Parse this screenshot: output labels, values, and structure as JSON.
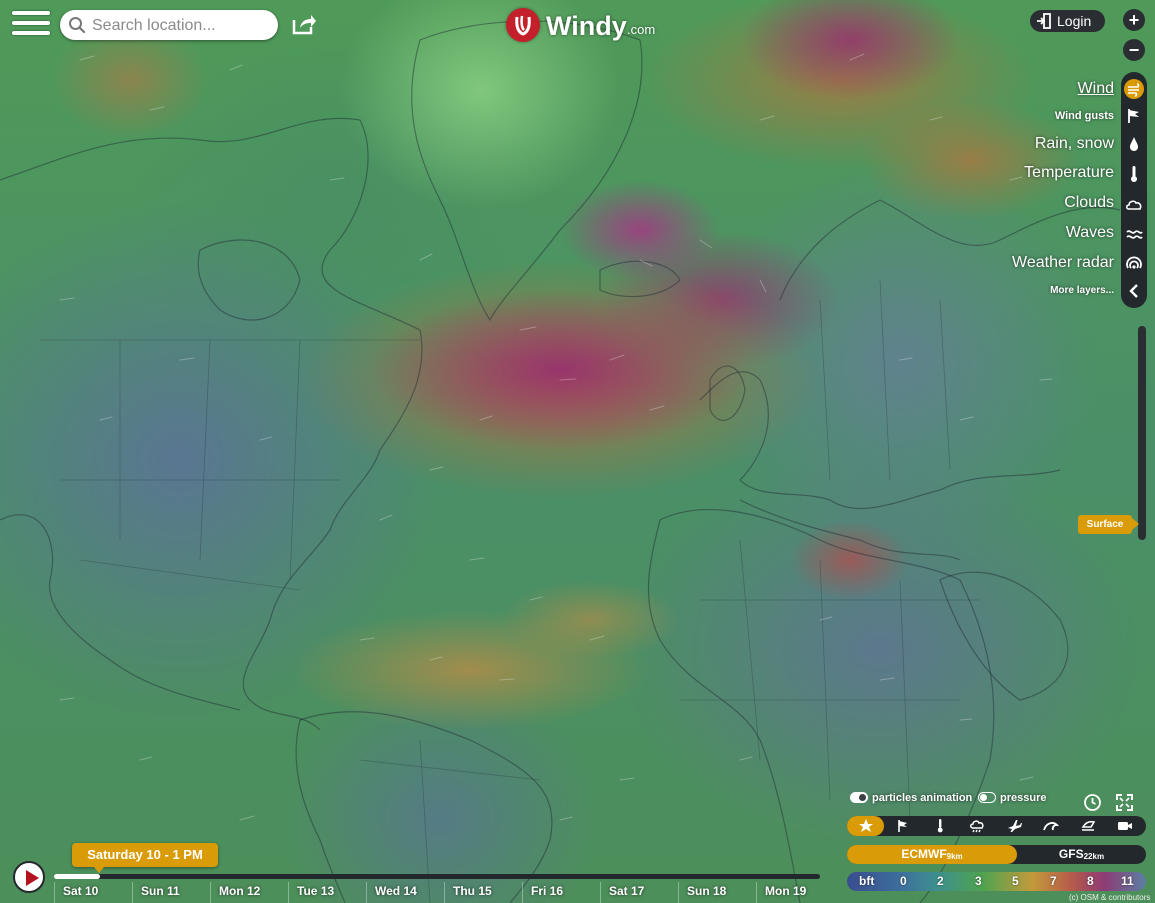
{
  "header": {
    "search_placeholder": "Search location...",
    "logo_word": "Windy",
    "logo_domain": ".com",
    "login_label": "Login",
    "zoom_in": "+",
    "zoom_out": "−"
  },
  "layers": [
    {
      "label": "Wind",
      "icon": "wind-icon",
      "active": true
    },
    {
      "label": "Wind gusts",
      "icon": "flag-icon",
      "active": false
    },
    {
      "label": "Rain, snow",
      "icon": "drop-icon",
      "active": false
    },
    {
      "label": "Temperature",
      "icon": "thermometer-icon",
      "active": false
    },
    {
      "label": "Clouds",
      "icon": "cloud-icon",
      "active": false
    },
    {
      "label": "Waves",
      "icon": "waves-icon",
      "active": false
    },
    {
      "label": "Weather radar",
      "icon": "radar-icon",
      "active": false
    },
    {
      "label": "More layers...",
      "icon": "chevron-left-icon",
      "active": false
    }
  ],
  "altitude": {
    "label": "Surface"
  },
  "toggles": {
    "particles": {
      "label": "particles animation",
      "on": true
    },
    "pressure": {
      "label": "pressure",
      "on": false
    }
  },
  "pickers": [
    "star-icon",
    "flag-icon",
    "thermometer-icon",
    "rain-cloud-icon",
    "plane-icon",
    "wave-icon",
    "kite-icon",
    "camera-icon"
  ],
  "models": {
    "active": {
      "name": "ECMWF",
      "res": "9km"
    },
    "other": {
      "name": "GFS",
      "res": "22km"
    }
  },
  "legend": {
    "unit": "bft",
    "values": [
      "0",
      "2",
      "3",
      "5",
      "7",
      "8",
      "11"
    ]
  },
  "credits": "(c) OSM & contributors",
  "timeline": {
    "current": "Saturday 10 - 1 PM",
    "progress_fraction": 0.06,
    "days": [
      "Sat 10",
      "Sun 11",
      "Mon 12",
      "Tue 13",
      "Wed 14",
      "Thu 15",
      "Fri 16",
      "Sat 17",
      "Sun 18",
      "Mon 19"
    ]
  },
  "colors": {
    "accent": "#d99b07",
    "panel": "#23282d",
    "logo_red": "#c3202b"
  }
}
